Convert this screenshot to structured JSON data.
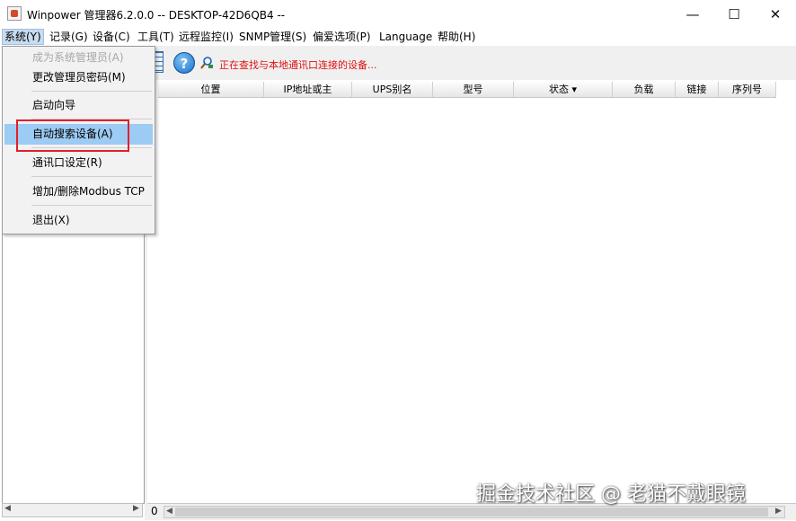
{
  "window": {
    "title": "Winpower 管理器6.2.0.0 -- DESKTOP-42D6QB4 --",
    "minimize": "—",
    "maximize": "☐",
    "close": "✕"
  },
  "menu": {
    "system": "系统(Y)",
    "records": "记录(G)",
    "device": "设备(C)",
    "tools": "工具(T)",
    "remote": "远程监控(I)",
    "snmp": "SNMP管理(S)",
    "prefs": "偏爱选项(P)",
    "language": "Language",
    "help": "帮助(H)"
  },
  "toolbar": {
    "help_icon": "?",
    "status": "正在查找与本地通讯口连接的设备..."
  },
  "system_menu": {
    "items": [
      {
        "label": "成为系统管理员(A)",
        "state": "disabled"
      },
      {
        "label": "更改管理员密码(M)",
        "state": "normal"
      },
      {
        "label": "启动向导",
        "state": "normal"
      },
      {
        "label": "自动搜索设备(A)",
        "state": "hover"
      },
      {
        "label": "通讯口设定(R)",
        "state": "normal"
      },
      {
        "label": "增加/删除Modbus TCP",
        "state": "normal"
      },
      {
        "label": "退出(X)",
        "state": "normal"
      }
    ]
  },
  "table": {
    "columns": [
      "位置",
      "IP地址或主",
      "UPS别名",
      "型号",
      "状态 ▾",
      "负载",
      "链接",
      "序列号"
    ]
  },
  "bottom": {
    "count": "0"
  },
  "watermark": "掘金技术社区 @ 老猫不戴眼镜",
  "colors": {
    "status_text": "#e01010",
    "menu_hover": "#9ccbf3",
    "annotation_box": "#e0202a"
  }
}
